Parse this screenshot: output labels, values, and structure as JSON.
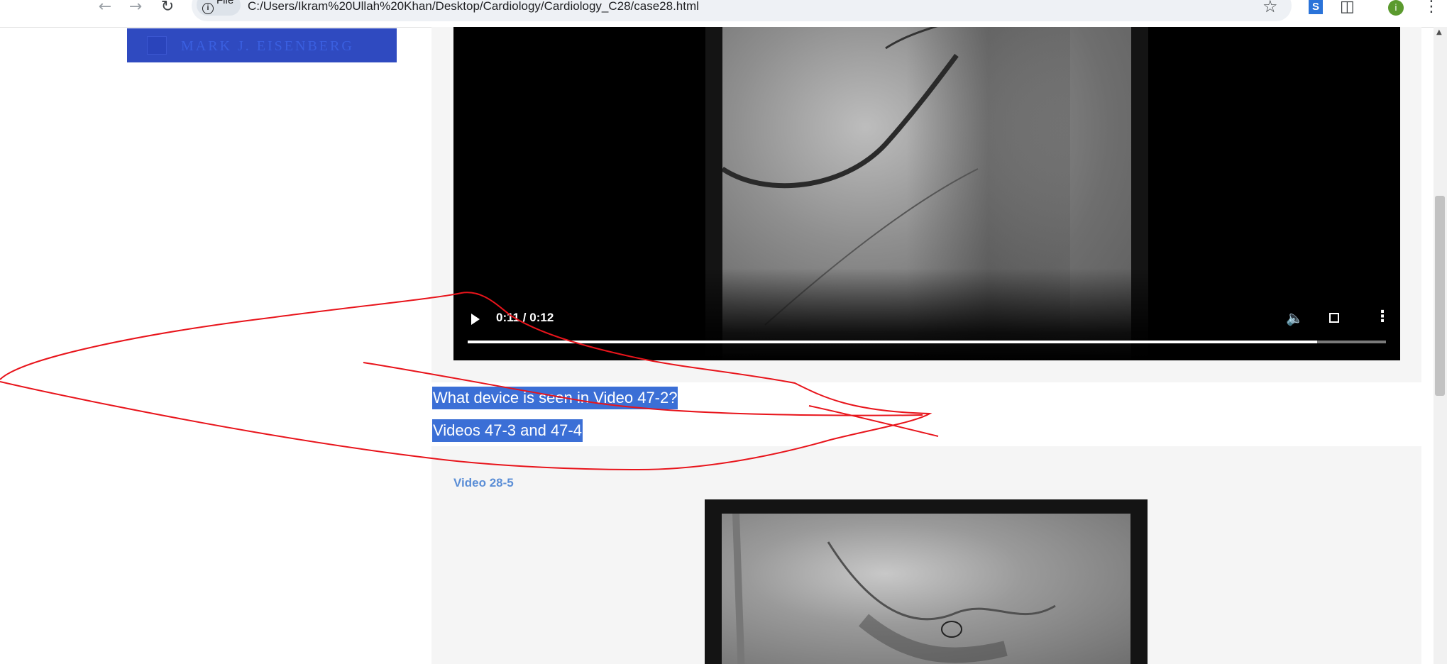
{
  "browser": {
    "file_label": "File",
    "url": "C:/Users/Ikram%20Ullah%20Khan/Desktop/Cardiology/Cardiology_C28/case28.html",
    "avatar_letter": "i"
  },
  "banner": {
    "author": "MARK J. EISENBERG"
  },
  "video_1": {
    "time": "0:11 / 0:12",
    "progress_fraction": 0.925
  },
  "text": {
    "question": "What device is seen in Video 47-2?",
    "videos_heading": "Videos 47-3 and 47-4"
  },
  "video_2": {
    "caption": "Video 28-5"
  },
  "colors": {
    "selection": "#3b6fd6",
    "annotation_stroke": "#e8141b",
    "caption": "#5b8ed6",
    "banner": "#2f4ac0"
  }
}
